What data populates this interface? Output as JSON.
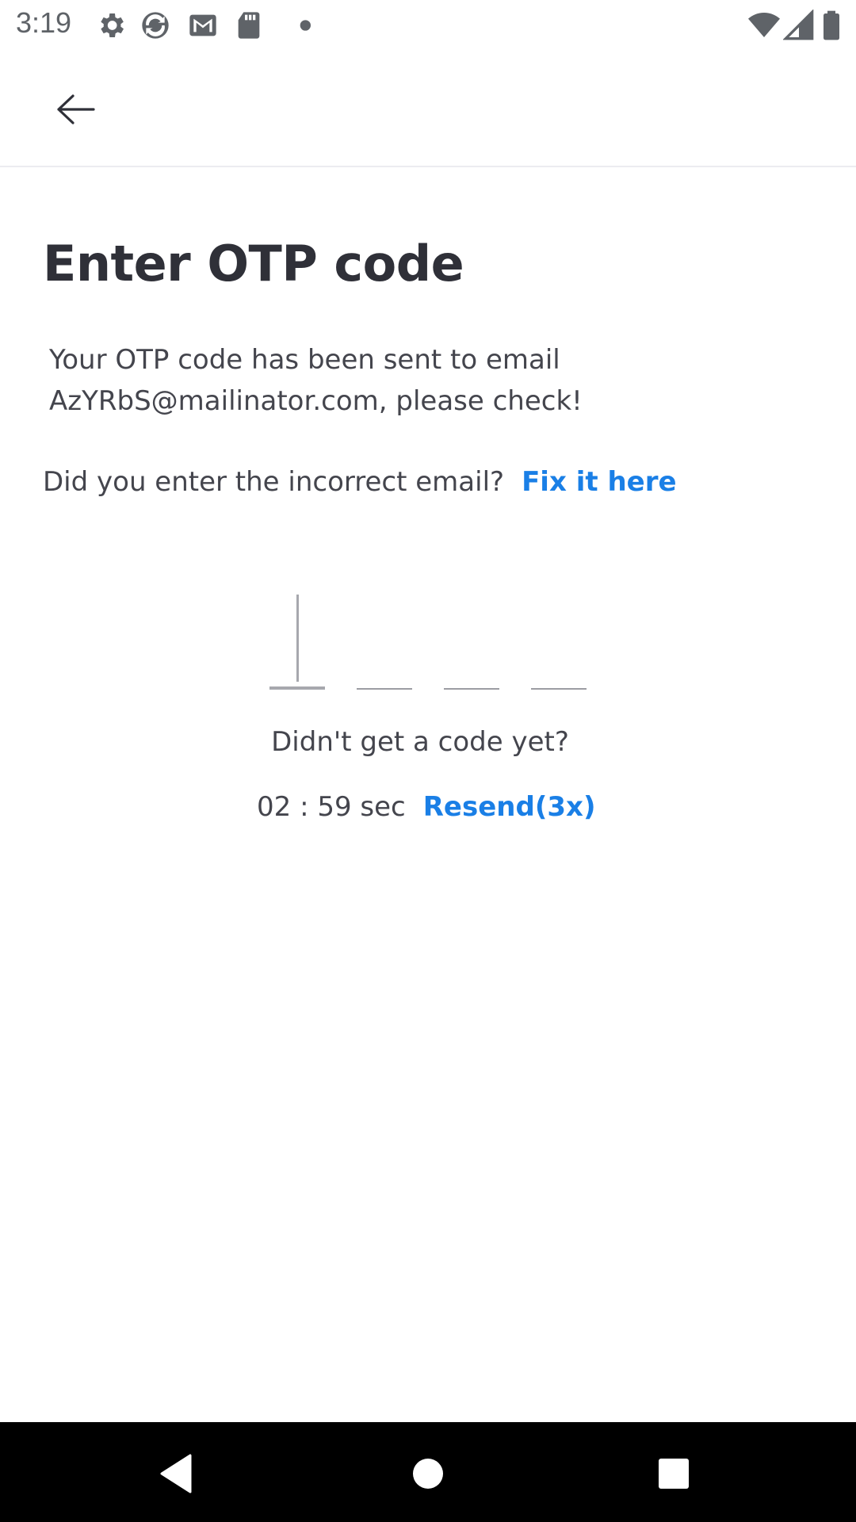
{
  "status_bar": {
    "time": "3:19",
    "icons": [
      "gear-icon",
      "sync-icon",
      "gmail-icon",
      "sd-card-icon",
      "dot-icon",
      "wifi-icon",
      "signal-icon",
      "battery-icon"
    ]
  },
  "app_bar": {
    "back_icon": "arrow-left-icon"
  },
  "main": {
    "title": "Enter OTP code",
    "info_line1": "Your OTP code has been sent to email",
    "info_line2": "AzYRbS@mailinator.com, please check!",
    "incorrect_email_question": "Did you enter the incorrect email?",
    "fix_link": "Fix it here",
    "otp_digits": [
      "",
      "",
      "",
      ""
    ],
    "no_code_text": "Didn't get a code yet?",
    "timer": "02 : 59 sec",
    "resend_link": "Resend(3x)"
  },
  "colors": {
    "link": "#1a7fe6",
    "title": "#2f3038",
    "body_text": "#44454d",
    "nav_bar": "#000000"
  },
  "nav_bar": {
    "icons": [
      "back-triangle-icon",
      "home-circle-icon",
      "recents-square-icon"
    ]
  }
}
